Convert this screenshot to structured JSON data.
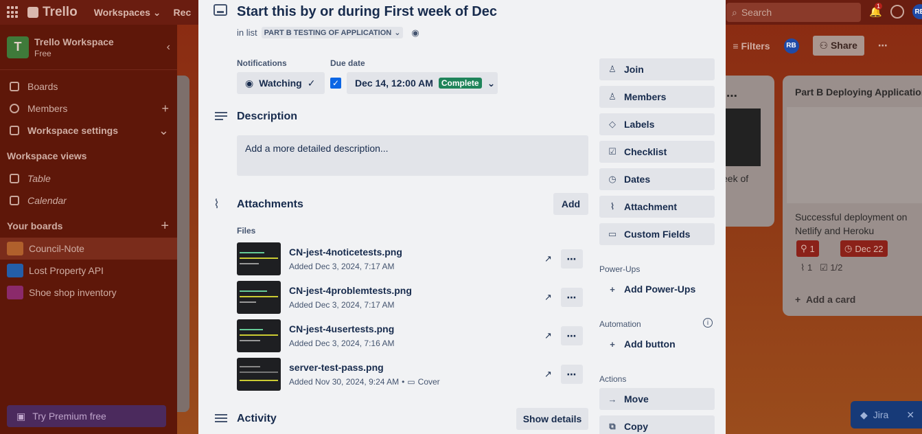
{
  "topbar": {
    "app_name": "Trello",
    "menu": [
      "Workspaces",
      "Rec"
    ],
    "search_placeholder": "Search",
    "notif_count": "1",
    "user_initials": "RB"
  },
  "sidebar": {
    "workspace_name": "Trello Workspace",
    "workspace_initial": "T",
    "workspace_plan": "Free",
    "items": [
      {
        "label": "Boards"
      },
      {
        "label": "Members"
      },
      {
        "label": "Workspace settings"
      }
    ],
    "views_heading": "Workspace views",
    "views": [
      {
        "label": "Table"
      },
      {
        "label": "Calendar"
      }
    ],
    "boards_heading": "Your boards",
    "boards": [
      {
        "label": "Council-Note",
        "color": "#b0602c"
      },
      {
        "label": "Lost Property API",
        "color": "#245ea8"
      },
      {
        "label": "Shoe shop inventory",
        "color": "#8b2a6b"
      }
    ],
    "premium_label": "Try Premium free"
  },
  "board": {
    "filters_label": "Filters",
    "share_label": "Share",
    "list_right_title": "Part B Deploying Application",
    "card_text": "Successful deployment on Netlify and Heroku",
    "card_badge_count": "1",
    "card_date": "Dec 22",
    "card_attach_count": "1",
    "card_checklist": "1/2",
    "add_card_label": "Add a card",
    "mid_card_text": "eek of",
    "jira_label": "Jira"
  },
  "card": {
    "title": "Start this by or during First week of Dec",
    "in_list_prefix": "in list",
    "list_name": "PART B TESTING OF APPLICATION",
    "notifications_label": "Notifications",
    "watching_label": "Watching",
    "due_date_label": "Due date",
    "due_date_value": "Dec 14, 12:00 AM",
    "due_status": "Complete",
    "description_title": "Description",
    "description_placeholder": "Add a more detailed description...",
    "attachments_title": "Attachments",
    "add_label": "Add",
    "files_label": "Files",
    "attachments": [
      {
        "name": "CN-jest-4noticetests.png",
        "added": "Added Dec 3, 2024, 7:17 AM",
        "cover": ""
      },
      {
        "name": "CN-jest-4problemtests.png",
        "added": "Added Dec 3, 2024, 7:17 AM",
        "cover": ""
      },
      {
        "name": "CN-jest-4usertests.png",
        "added": "Added Dec 3, 2024, 7:16 AM",
        "cover": ""
      },
      {
        "name": "server-test-pass.png",
        "added": "Added Nov 30, 2024, 9:24 AM",
        "cover": "Cover"
      }
    ],
    "activity_title": "Activity",
    "show_details_label": "Show details"
  },
  "side": {
    "buttons": [
      {
        "label": "Join",
        "icon": "person-icon"
      },
      {
        "label": "Members",
        "icon": "members-icon"
      },
      {
        "label": "Labels",
        "icon": "tag-icon"
      },
      {
        "label": "Checklist",
        "icon": "checklist-icon"
      },
      {
        "label": "Dates",
        "icon": "clock-icon"
      },
      {
        "label": "Attachment",
        "icon": "paperclip-icon"
      },
      {
        "label": "Custom Fields",
        "icon": "custom-fields-icon"
      }
    ],
    "powerups_heading": "Power-Ups",
    "add_powerups_label": "Add Power-Ups",
    "automation_heading": "Automation",
    "add_button_label": "Add button",
    "actions_heading": "Actions",
    "move_label": "Move",
    "copy_label": "Copy"
  }
}
